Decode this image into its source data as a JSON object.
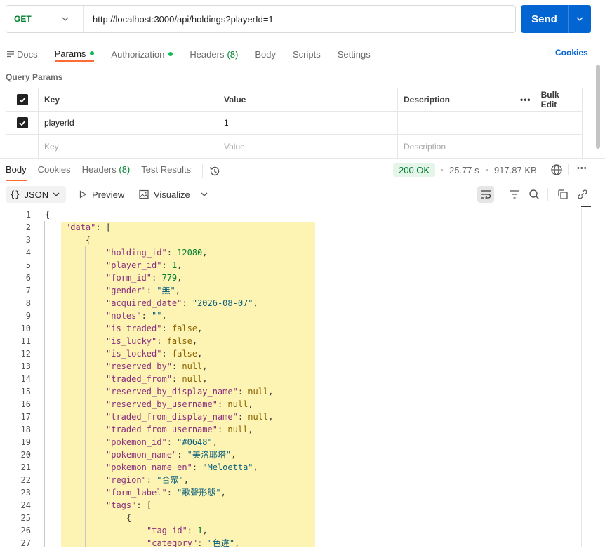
{
  "request": {
    "method": "GET",
    "url": "http://localhost:3000/api/holdings?playerId=1",
    "send_label": "Send"
  },
  "req_tabs": [
    {
      "label": "Docs"
    },
    {
      "label": "Params",
      "dot": true
    },
    {
      "label": "Authorization",
      "dot": true
    },
    {
      "label": "Headers",
      "count": "(8)"
    },
    {
      "label": "Body"
    },
    {
      "label": "Scripts"
    },
    {
      "label": "Settings"
    }
  ],
  "cookies_label": "Cookies",
  "query_params": {
    "title": "Query Params",
    "headers": {
      "key": "Key",
      "value": "Value",
      "description": "Description",
      "bulk_edit": "Bulk Edit"
    },
    "rows": [
      {
        "checked": true,
        "key": "playerId",
        "value": "1",
        "description": ""
      }
    ],
    "placeholders": {
      "key": "Key",
      "value": "Value",
      "description": "Description"
    }
  },
  "response": {
    "tabs": [
      {
        "label": "Body"
      },
      {
        "label": "Cookies"
      },
      {
        "label": "Headers",
        "count": "(8)"
      },
      {
        "label": "Test Results"
      }
    ],
    "status": "200 OK",
    "time": "25.77 s",
    "size": "917.87 KB",
    "format": "JSON",
    "preview_label": "Preview",
    "visualize_label": "Visualize"
  },
  "code_lines": [
    {
      "n": "1",
      "indent": 0,
      "t": "{"
    },
    {
      "n": "2",
      "indent": 1,
      "t": "\"data\": ["
    },
    {
      "n": "3",
      "indent": 2,
      "t": "{"
    },
    {
      "n": "4",
      "indent": 3,
      "t": "\"holding_id\": 12080,"
    },
    {
      "n": "5",
      "indent": 3,
      "t": "\"player_id\": 1,"
    },
    {
      "n": "6",
      "indent": 3,
      "t": "\"form_id\": 779,"
    },
    {
      "n": "7",
      "indent": 3,
      "t": "\"gender\": \"無\","
    },
    {
      "n": "8",
      "indent": 3,
      "t": "\"acquired_date\": \"2026-08-07\","
    },
    {
      "n": "9",
      "indent": 3,
      "t": "\"notes\": \"\","
    },
    {
      "n": "10",
      "indent": 3,
      "t": "\"is_traded\": false,"
    },
    {
      "n": "11",
      "indent": 3,
      "t": "\"is_lucky\": false,"
    },
    {
      "n": "12",
      "indent": 3,
      "t": "\"is_locked\": false,"
    },
    {
      "n": "13",
      "indent": 3,
      "t": "\"reserved_by\": null,"
    },
    {
      "n": "14",
      "indent": 3,
      "t": "\"traded_from\": null,"
    },
    {
      "n": "15",
      "indent": 3,
      "t": "\"reserved_by_display_name\": null,"
    },
    {
      "n": "16",
      "indent": 3,
      "t": "\"reserved_by_username\": null,"
    },
    {
      "n": "17",
      "indent": 3,
      "t": "\"traded_from_display_name\": null,"
    },
    {
      "n": "18",
      "indent": 3,
      "t": "\"traded_from_username\": null,"
    },
    {
      "n": "19",
      "indent": 3,
      "t": "\"pokemon_id\": \"#0648\","
    },
    {
      "n": "20",
      "indent": 3,
      "t": "\"pokemon_name\": \"美洛耶塔\","
    },
    {
      "n": "21",
      "indent": 3,
      "t": "\"pokemon_name_en\": \"Meloetta\","
    },
    {
      "n": "22",
      "indent": 3,
      "t": "\"region\": \"合眾\","
    },
    {
      "n": "23",
      "indent": 3,
      "t": "\"form_label\": \"歌聲形態\","
    },
    {
      "n": "24",
      "indent": 3,
      "t": "\"tags\": ["
    },
    {
      "n": "25",
      "indent": 4,
      "t": "{"
    },
    {
      "n": "26",
      "indent": 5,
      "t": "\"tag_id\": 1,"
    },
    {
      "n": "27",
      "indent": 5,
      "t": "\"category\": \"色違\","
    }
  ],
  "colors": {
    "accent": "#ff6c37",
    "send": "#0265d2",
    "highlight": "#fdf4b3",
    "status_ok": "#007f31"
  }
}
